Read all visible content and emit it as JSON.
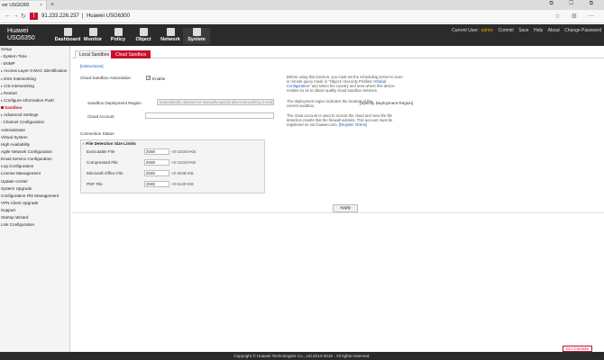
{
  "browser": {
    "tab_title": "ver USG6300",
    "tab_close": "×",
    "new_tab": "+",
    "window_controls": "⧉ ☐ ⧉",
    "warning_badge": "!",
    "url_host": "91.233.226.237",
    "url_title": "Huawei USG6300",
    "address_right_icons": "☆ ⚙ ⋯"
  },
  "header": {
    "brand_line1": "Huawei",
    "brand_line2": "USG6350",
    "menu": [
      {
        "label": "Dashboard",
        "icon": "dashboard-icon"
      },
      {
        "label": "Monitor",
        "icon": "monitor-icon"
      },
      {
        "label": "Policy",
        "icon": "policy-icon"
      },
      {
        "label": "Object",
        "icon": "object-icon"
      },
      {
        "label": "Network",
        "icon": "network-icon"
      },
      {
        "label": "System",
        "icon": "system-icon"
      }
    ],
    "active_menu": "System",
    "current_user_label": "Current User:",
    "current_user": "admin",
    "actions": [
      "Commit",
      "Save",
      "Help",
      "About",
      "Change Password"
    ]
  },
  "sidebar": {
    "items": [
      {
        "label": "Setup",
        "prefix": ""
      },
      {
        "label": "System Time",
        "prefix": "›"
      },
      {
        "label": "SNMP",
        "prefix": "›"
      },
      {
        "label": "Access-Layer-3 MAC Identification",
        "prefix": "▸"
      },
      {
        "label": "DSS Interworking",
        "prefix": "▸"
      },
      {
        "label": "CIS Interworking",
        "prefix": "▸"
      },
      {
        "label": "Restart",
        "prefix": "▸"
      },
      {
        "label": "Configure Information Push",
        "prefix": "▸"
      },
      {
        "label": "Sandbox",
        "prefix": "▸"
      },
      {
        "label": "Advanced Settings",
        "prefix": "▸"
      },
      {
        "label": "Channel Configuration",
        "prefix": "›"
      },
      {
        "label": "Administrator",
        "prefix": ""
      },
      {
        "label": "Virtual System",
        "prefix": ""
      },
      {
        "label": "High Availability",
        "prefix": ""
      },
      {
        "label": "Agile Network Configuration",
        "prefix": ""
      },
      {
        "label": "Email Service Configuration",
        "prefix": ""
      },
      {
        "label": "Log Configuration",
        "prefix": ""
      },
      {
        "label": "License Management",
        "prefix": ""
      },
      {
        "label": "Update Center",
        "prefix": ""
      },
      {
        "label": "System Upgrade",
        "prefix": ""
      },
      {
        "label": "Configuration File Management",
        "prefix": ""
      },
      {
        "label": "VPN Client Upgrade",
        "prefix": ""
      },
      {
        "label": "Support",
        "prefix": ""
      },
      {
        "label": "Startup Wizard",
        "prefix": ""
      },
      {
        "label": "Link Configuration",
        "prefix": ""
      }
    ],
    "active": "Sandbox"
  },
  "content": {
    "tabs": [
      "Local Sandbox",
      "Cloud Sandbox"
    ],
    "active_tab": "Cloud Sandbox",
    "instructions_link": "[Instructions]",
    "association_label": "Cloud Sandbox Association",
    "enable_checked": true,
    "enable_label": "Enable",
    "help_association_pre": "Before using this function, you must set the scheduling server to scan in remote query mode in \"Object->Security Profiles->",
    "help_association_link": "Global Configuration",
    "help_association_post": "\" and select the country and area where this device resides so as to obtain quality cloud sandbox services.",
    "region_label": "Sandbox Deployment Region",
    "region_placeholder": "automatically obtained or manually specify after interworking is enabled",
    "help_region": "The deployment region indicates the location of the current sandbox.",
    "help_region_link": "[Specify Deployment Region]",
    "account_label": "Cloud Account",
    "account_value": "",
    "help_account_pre": "The cloud account is used to access the cloud and view the file detection results that the firewall submits. This account must be registered on sec.huawei.com.",
    "help_account_link": "[Register Online]",
    "connection_status_label": "Connection Status",
    "file_limits_title": "File Detection Size Limits",
    "file_limits_prefix": "▪",
    "file_rows": [
      {
        "label": "Executable File",
        "value": "2048",
        "range": "<0-10240>KB"
      },
      {
        "label": "Compressed File",
        "value": "2048",
        "range": "<0-10240>KB"
      },
      {
        "label": "Microsoft Office File",
        "value": "2048",
        "range": "<0-2048>KB"
      },
      {
        "label": "PDF File",
        "value": "2048",
        "range": "<0-5120>KB"
      }
    ],
    "apply_label": "Apply",
    "cli_console_label": "CLI Console"
  },
  "footer": {
    "copyright": "Copyright © Huawei Technologies Co., Ltd.2014-2018 . All rights reserved."
  },
  "colors": {
    "accent": "#c8102e",
    "header_bg": "#2b2b2b",
    "sidebar_bg": "#f4f4f4",
    "link": "#1a5fb4"
  }
}
